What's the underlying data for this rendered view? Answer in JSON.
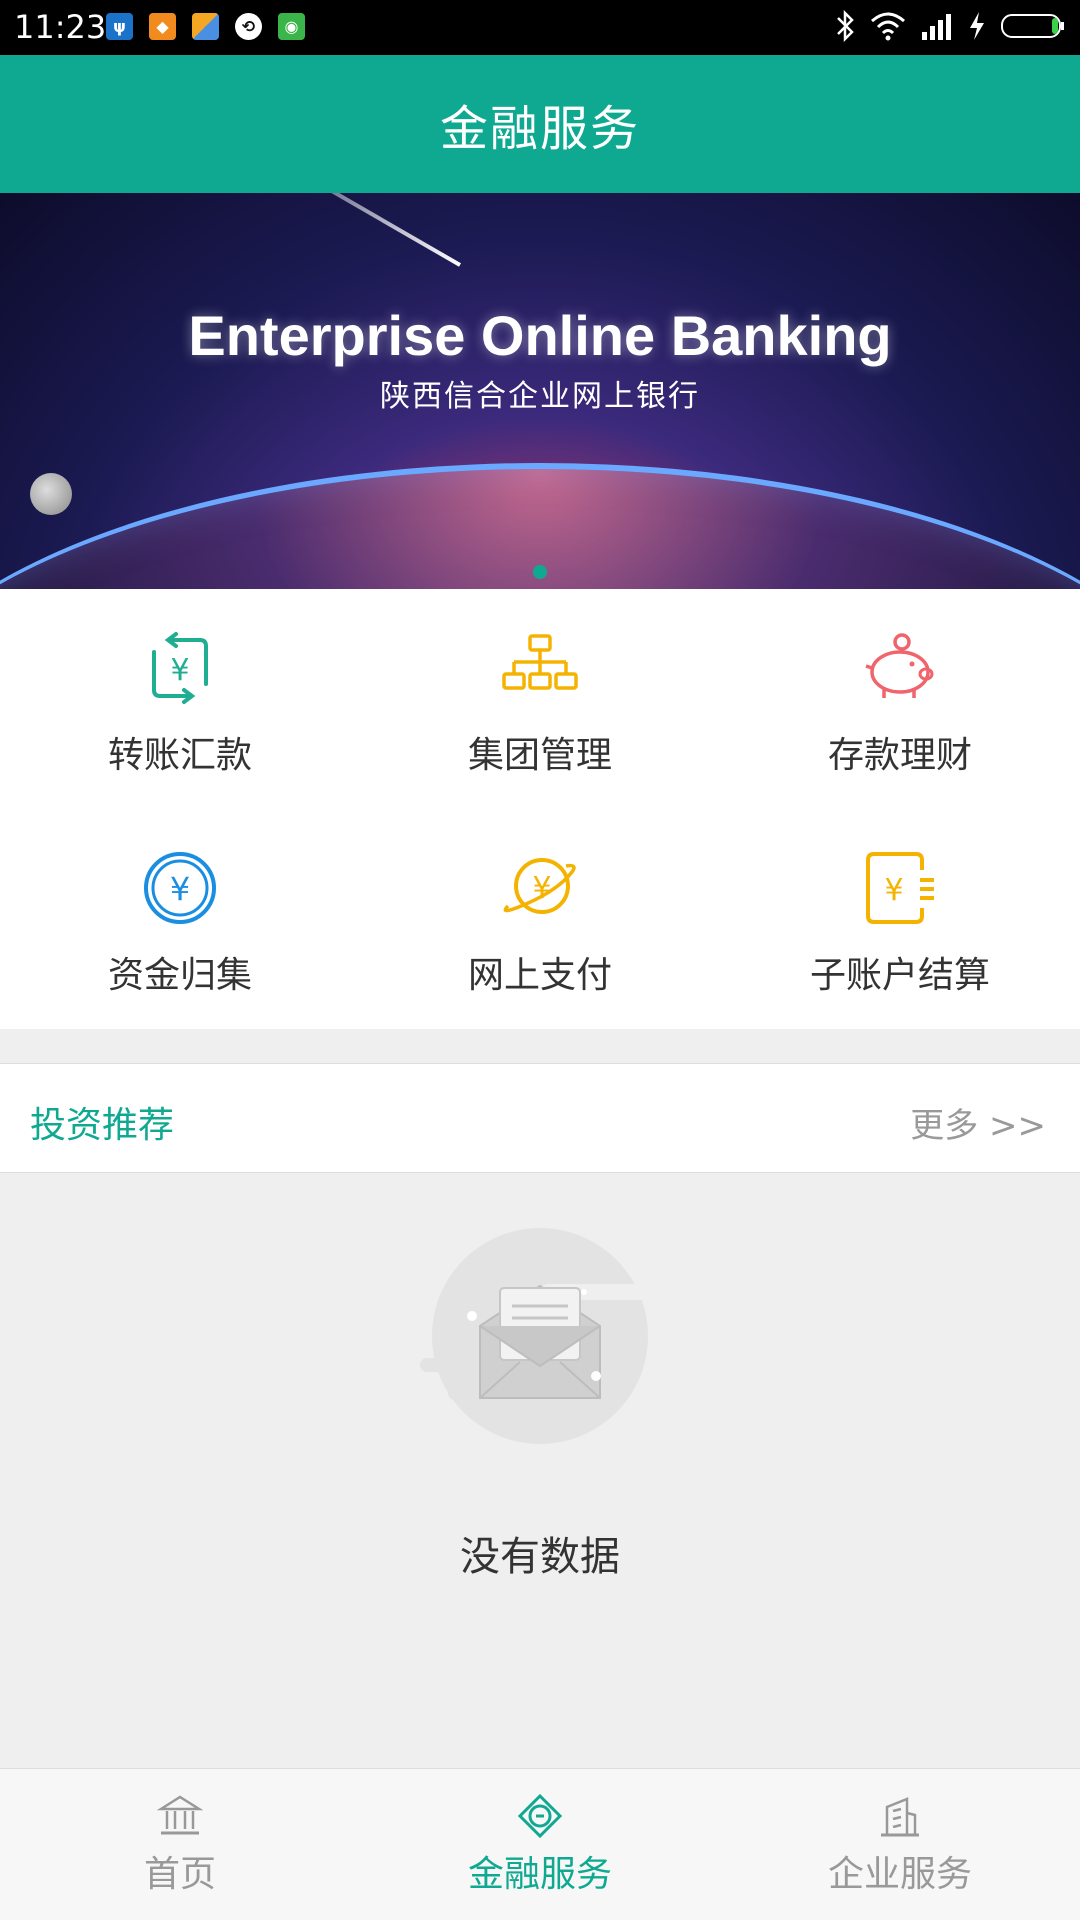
{
  "status_bar": {
    "time": "11:23"
  },
  "header": {
    "title": "金融服务"
  },
  "banner": {
    "title_en": "Enterprise Online Banking",
    "title_cn": "陕西信合企业网上银行"
  },
  "menu": {
    "items": [
      {
        "label": "转账汇款",
        "icon": "transfer-icon",
        "color": "#1fae91"
      },
      {
        "label": "集团管理",
        "icon": "org-chart-icon",
        "color": "#f5b301"
      },
      {
        "label": "存款理财",
        "icon": "piggy-bank-icon",
        "color": "#f0646b"
      },
      {
        "label": "资金归集",
        "icon": "yuan-coin-icon",
        "color": "#1a8ee0"
      },
      {
        "label": "网上支付",
        "icon": "online-pay-icon",
        "color": "#f5b301"
      },
      {
        "label": "子账户结算",
        "icon": "sub-account-icon",
        "color": "#f5b301"
      }
    ]
  },
  "recommend": {
    "title": "投资推荐",
    "more": "更多 >>"
  },
  "empty_state": {
    "text": "没有数据"
  },
  "bottom_nav": {
    "items": [
      {
        "label": "首页",
        "icon": "bank-icon",
        "active": false
      },
      {
        "label": "金融服务",
        "icon": "finance-icon",
        "active": true
      },
      {
        "label": "企业服务",
        "icon": "building-icon",
        "active": false
      }
    ]
  },
  "colors": {
    "primary": "#0fa991",
    "background": "#efefef"
  }
}
